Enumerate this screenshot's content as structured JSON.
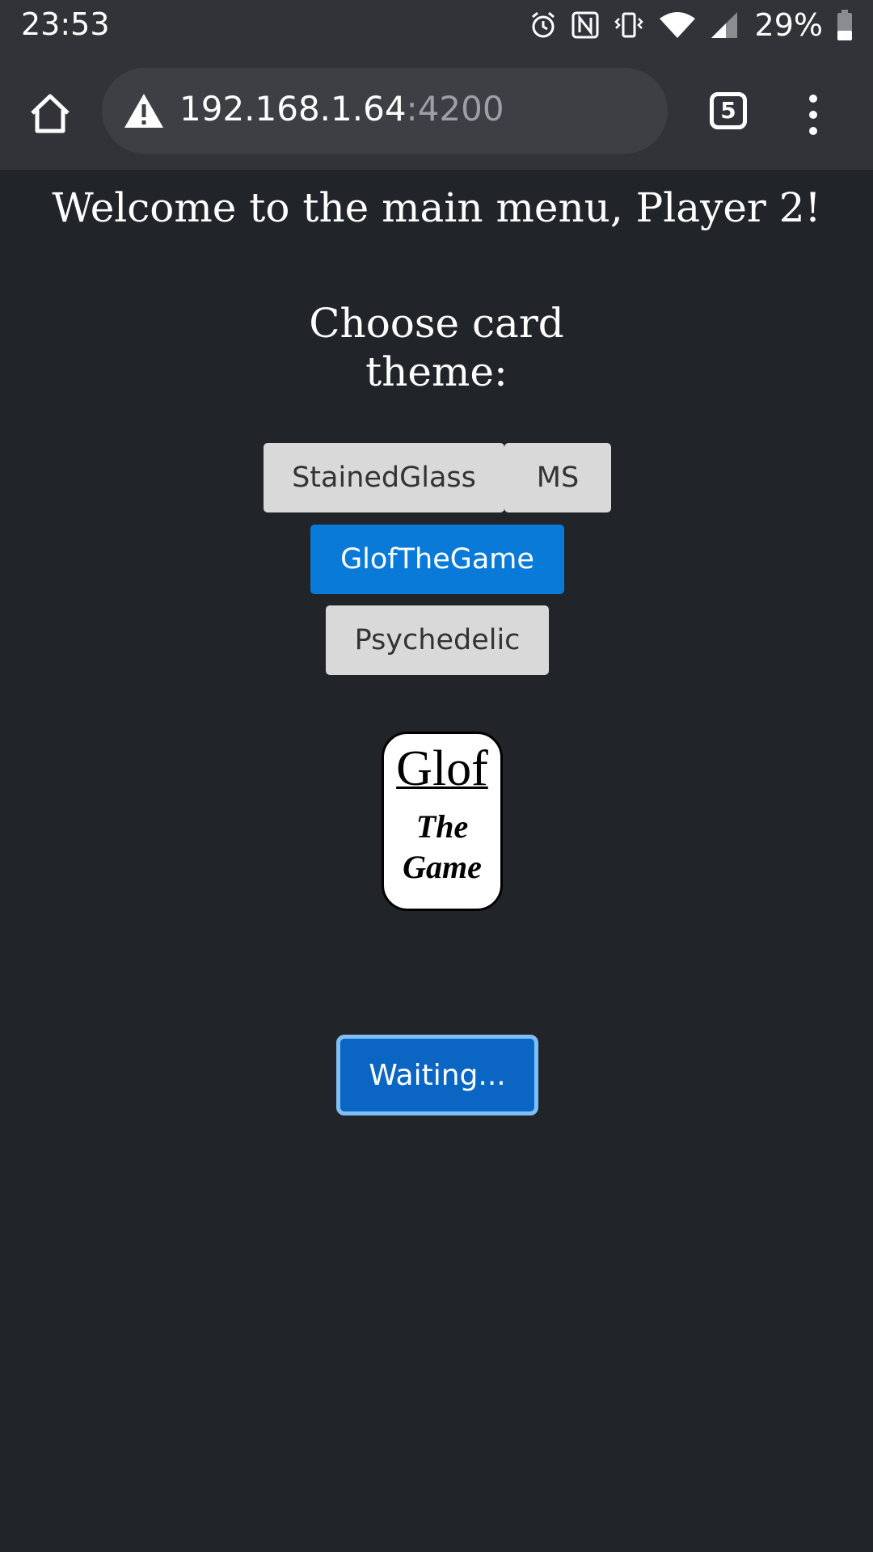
{
  "status_bar": {
    "time": "23:53",
    "battery_percent": "29%",
    "icons": [
      "alarm-icon",
      "nfc-icon",
      "vibrate-icon",
      "wifi-icon",
      "signal-icon",
      "battery-icon"
    ]
  },
  "browser": {
    "url_host": "192.168.1.64",
    "url_port": ":4200",
    "tab_count": "5",
    "icons": [
      "home-icon",
      "warning-icon",
      "tabs-icon",
      "overflow-menu-icon"
    ]
  },
  "page": {
    "welcome": "Welcome to the main menu, Player 2!",
    "choose_theme_line1": "Choose card",
    "choose_theme_line2": "theme:",
    "themes": [
      {
        "label": "StainedGlass",
        "selected": false
      },
      {
        "label": "MS",
        "selected": false
      },
      {
        "label": "GlofTheGame",
        "selected": true
      },
      {
        "label": "Psychedelic",
        "selected": false
      }
    ],
    "card_preview": {
      "line1": "Glof",
      "line2": "The",
      "line3": "Game"
    },
    "waiting_button": "Waiting..."
  },
  "colors": {
    "background": "#212429",
    "accent": "#0a7ad9",
    "waiting_button": "#0b66c3",
    "button_gray": "#d9d9d9"
  }
}
